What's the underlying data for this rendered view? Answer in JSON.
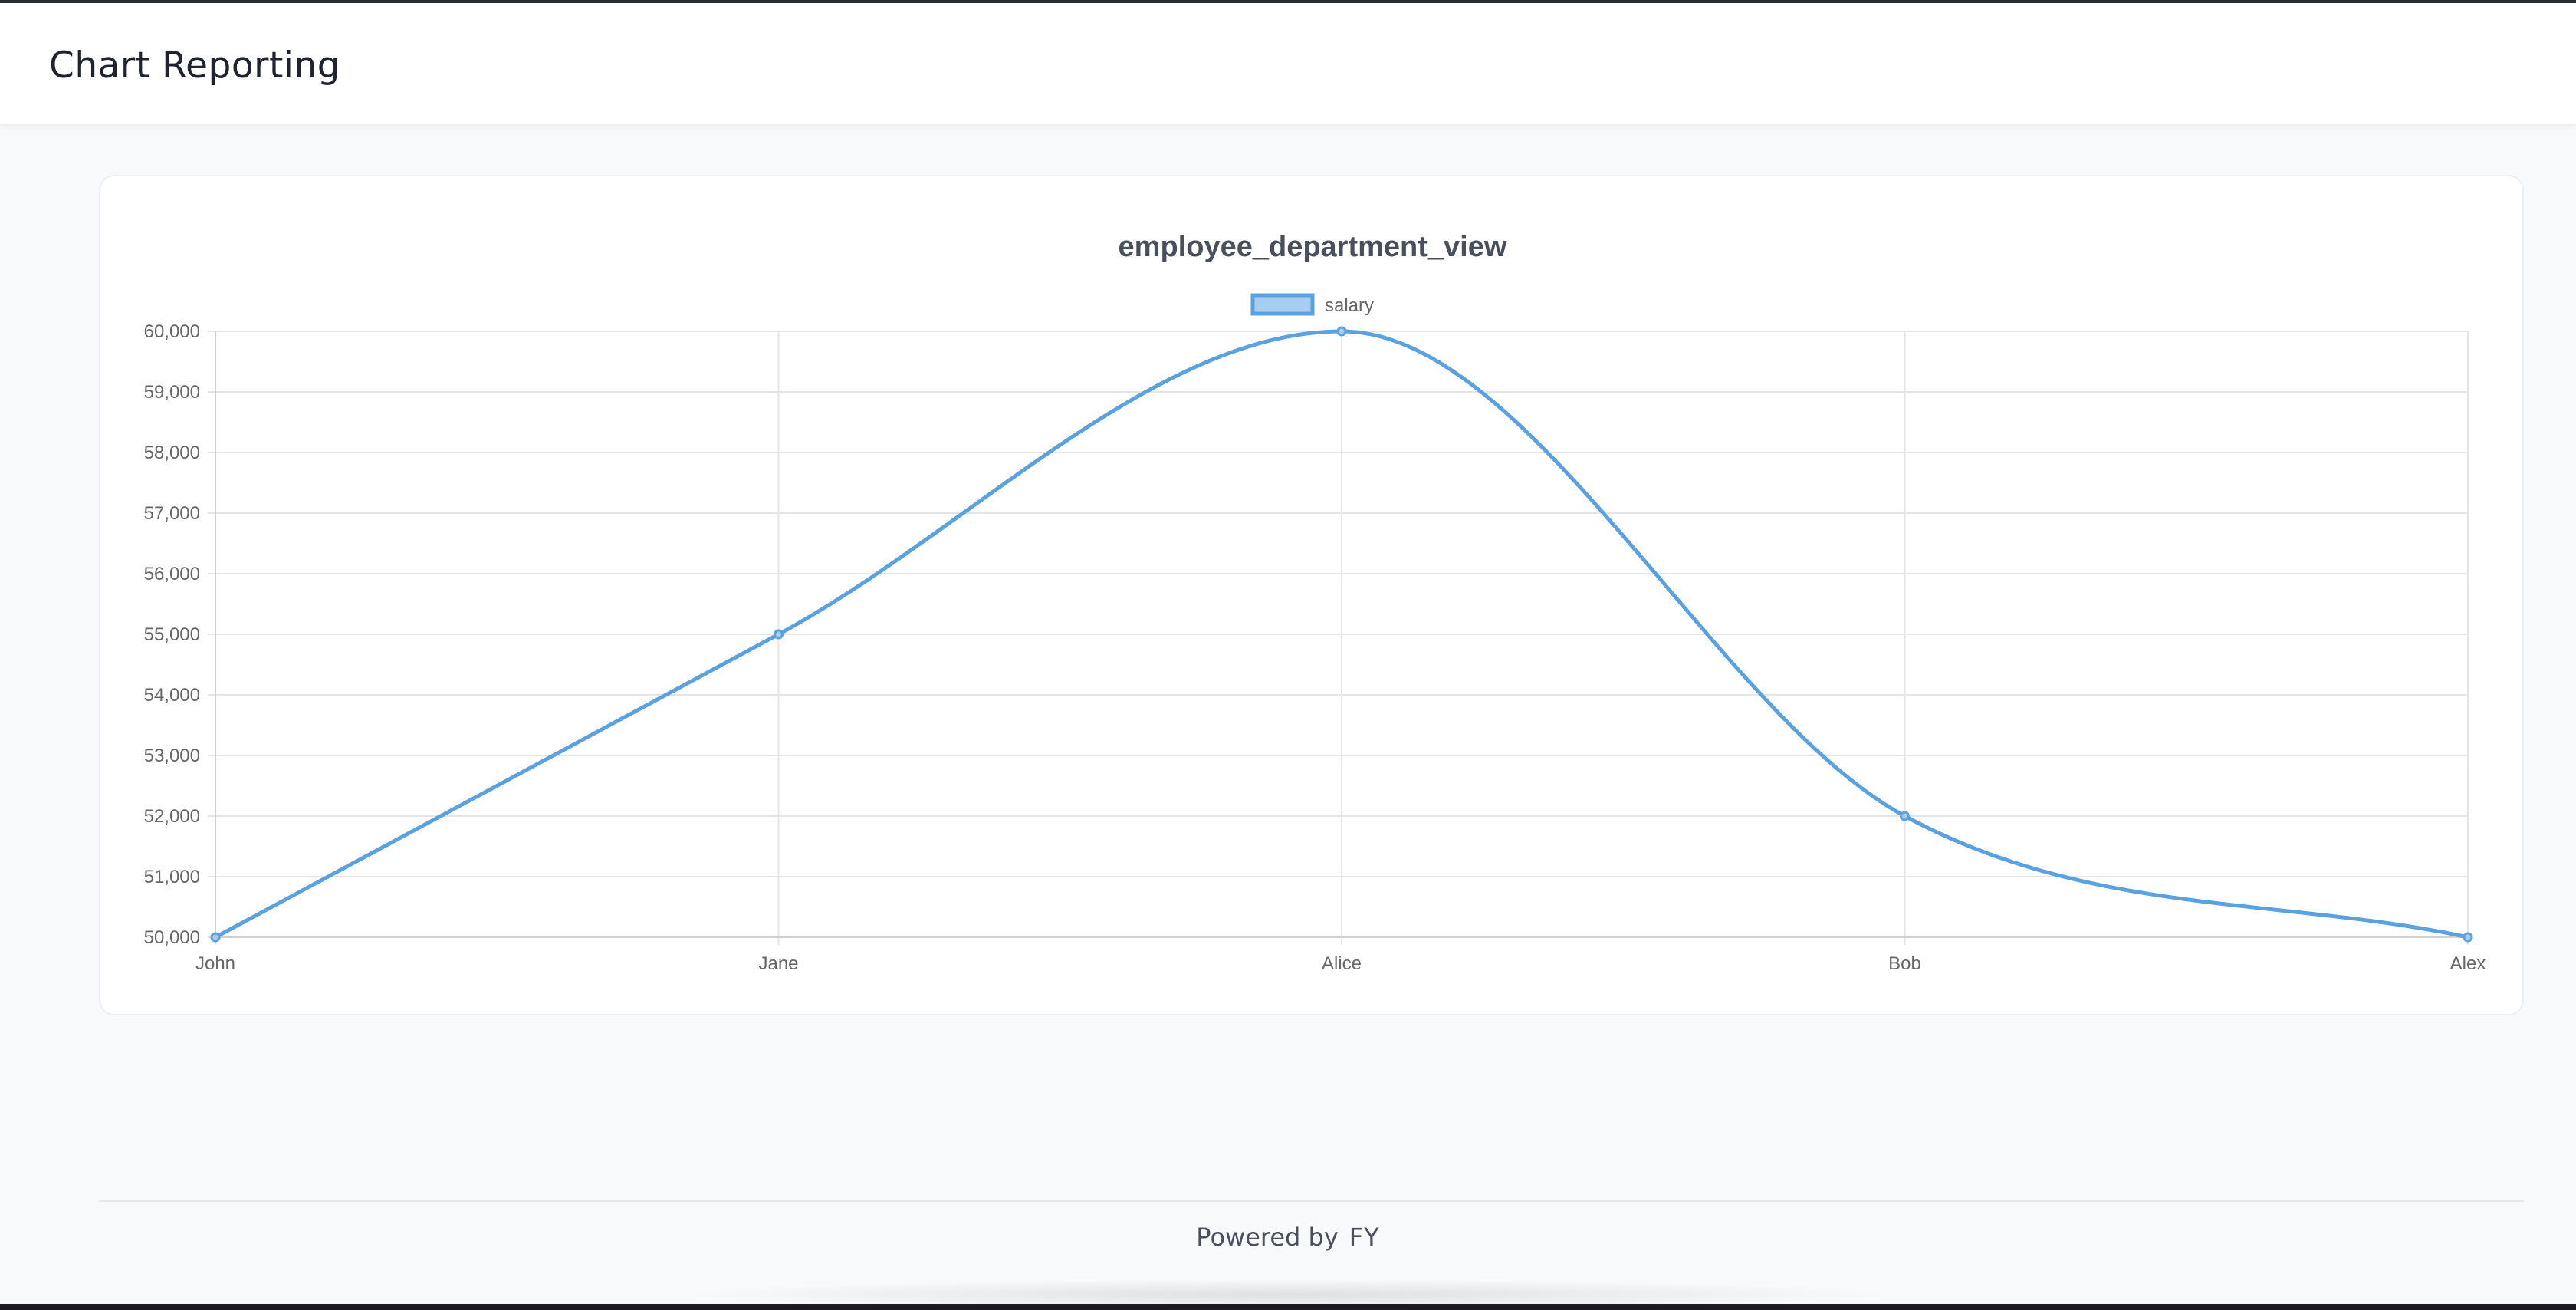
{
  "header": {
    "title": "Chart Reporting"
  },
  "footer": {
    "powered_by": "Powered by",
    "brand": "FY"
  },
  "colors": {
    "series": "#5aa1e0",
    "series_fill": "#a9cdf1",
    "grid": "#e5e5e5",
    "text": "#666666",
    "title": "#4a4f5c"
  },
  "chart_data": {
    "type": "line",
    "title": "employee_department_view",
    "categories": [
      "John",
      "Jane",
      "Alice",
      "Bob",
      "Alex"
    ],
    "series": [
      {
        "name": "salary",
        "values": [
          50000,
          55000,
          60000,
          52000,
          50000
        ]
      }
    ],
    "ylim": [
      50000,
      60000
    ],
    "y_ticks": [
      "60,000",
      "59,000",
      "58,000",
      "57,000",
      "56,000",
      "55,000",
      "54,000",
      "53,000",
      "52,000",
      "51,000",
      "50,000"
    ],
    "grid": true,
    "legend": "top-center",
    "smooth": true
  }
}
